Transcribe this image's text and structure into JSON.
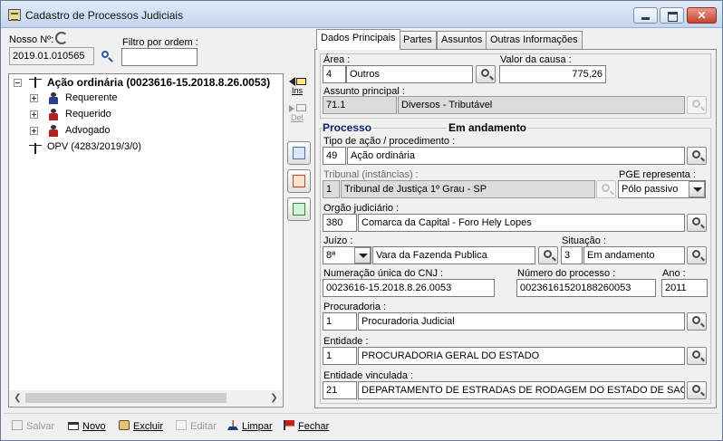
{
  "window": {
    "title": "Cadastro de Processos Judiciais",
    "close_glyph": "✕"
  },
  "left": {
    "nosso_label": "Nosso Nº:",
    "nosso_value": "2019.01.010565",
    "filtro_label": "Filtro por ordem :",
    "filtro_value": "",
    "tree": [
      {
        "label": "Ação ordinária (0023616-15.2018.8.26.0053)",
        "icon": "scales-icon"
      },
      {
        "label": "Requerente",
        "icon": "person-icon"
      },
      {
        "label": "Requerido",
        "icon": "person-icon"
      },
      {
        "label": "Advogado",
        "icon": "person-icon"
      },
      {
        "label": "OPV (4283/2019/3/0)",
        "icon": "scales-icon"
      }
    ],
    "ins_label": "Ins",
    "del_label": "Del"
  },
  "tabs": [
    {
      "label": "Dados Principais",
      "active": true
    },
    {
      "label": "Partes",
      "active": false
    },
    {
      "label": "Assuntos",
      "active": false
    },
    {
      "label": "Outras Informações",
      "active": false
    }
  ],
  "form": {
    "area_label": "Área :",
    "area_code": "4",
    "area_value": "Outros",
    "valor_label": "Valor da causa :",
    "valor_value": "775,26",
    "assunto_label": "Assunto principal :",
    "assunto_code": "71.1",
    "assunto_value": "Diversos - Tributável",
    "processo_heading": "Processo",
    "status_heading": "Em andamento",
    "tipo_label": "Tipo de ação / procedimento :",
    "tipo_code": "49",
    "tipo_value": "Ação ordinária",
    "tribunal_label": "Tribunal (instâncias) :",
    "tribunal_code": "1",
    "tribunal_value": "Tribunal de Justiça 1º Grau - SP",
    "pge_label": "PGE representa :",
    "pge_value": "Pólo passivo",
    "orgao_label": "Orgão judiciário :",
    "orgao_code": "380",
    "orgao_value": "Comarca da Capital - Foro Hely Lopes",
    "juizo_label": "Juízo :",
    "juizo_code": "8ª",
    "juizo_value": "Vara da Fazenda Publica",
    "situacao_label": "Situação :",
    "situacao_code": "3",
    "situacao_value": "Em andamento",
    "cnj_label": "Numeração única do CNJ :",
    "cnj_value": "0023616-15.2018.8.26.0053",
    "numero_label": "Número do processo :",
    "numero_value": "00236161520188260053",
    "ano_label": "Ano :",
    "ano_value": "2011",
    "procuradoria_label": "Procuradoria :",
    "procuradoria_code": "1",
    "procuradoria_value": "Procuradoria Judicial",
    "entidade_label": "Entidade :",
    "entidade_code": "1",
    "entidade_value": "PROCURADORIA GERAL DO ESTADO",
    "vinculada_label": "Entidade vinculada :",
    "vinculada_code": "21",
    "vinculada_value": "DEPARTAMENTO DE ESTRADAS DE RODAGEM DO ESTADO DE SAO"
  },
  "toolbar": {
    "salvar": "Salvar",
    "novo": "Novo",
    "excluir": "Excluir",
    "editar": "Editar",
    "limpar": "Limpar",
    "fechar": "Fechar"
  }
}
